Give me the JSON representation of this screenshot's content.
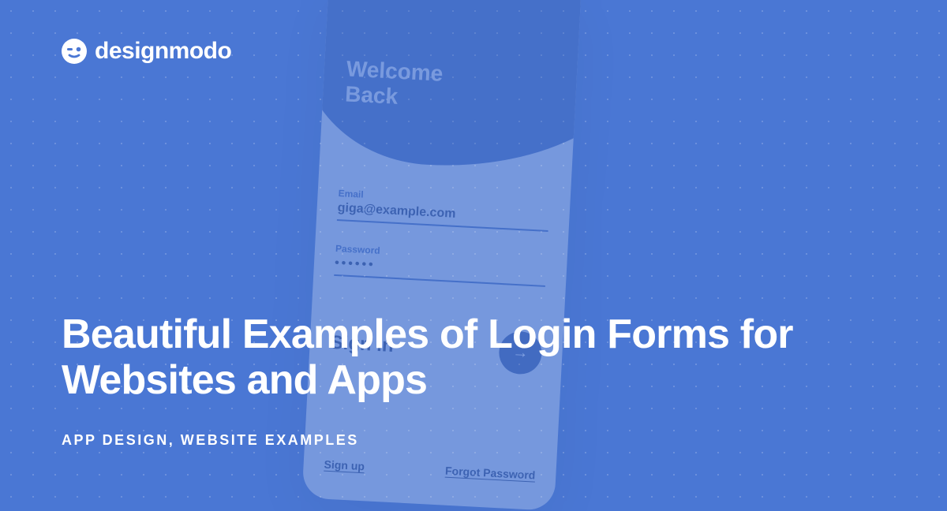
{
  "brand": {
    "name": "designmodo"
  },
  "article": {
    "title": "Beautiful Examples of Login Forms for Websites and Apps",
    "categories": "APP DESIGN, WEBSITE EXAMPLES"
  },
  "mockup": {
    "heading_line1": "Welcome",
    "heading_line2": "Back",
    "email_label": "Email",
    "email_value": "giga@example.com",
    "password_label": "Password",
    "password_mask": "••••••",
    "signin_label": "Sign in",
    "signup_link": "Sign up",
    "forgot_link": "Forgot Password"
  }
}
